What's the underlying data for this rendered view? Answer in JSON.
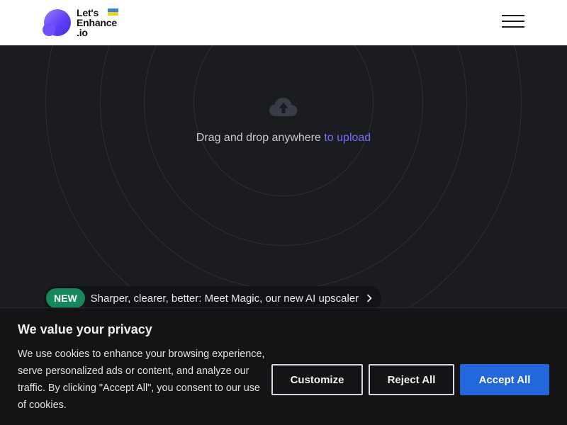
{
  "brand": {
    "logo_text_line1": "Let's",
    "logo_text_line2": "Enhance",
    "logo_text_line3": ".io",
    "flag_colors": [
      "#2f86e0",
      "#f5d21a"
    ],
    "accent": "#6f4ff7"
  },
  "header": {
    "menu_icon": "hamburger-icon"
  },
  "hero": {
    "upload_icon": "cloud-upload-icon",
    "drop_text": "Drag and drop anywhere",
    "drop_link": "to upload",
    "link_color": "#7a6cff"
  },
  "announcement": {
    "badge": "NEW",
    "text": "Sharper, clearer, better: Meet Magic, our new AI upscaler",
    "icon": "chevron-right-icon",
    "badge_color": "#14885a"
  },
  "cookie_banner": {
    "title": "We value your privacy",
    "body": "We use cookies to enhance your browsing experience, serve personalized ads or content, and analyze our traffic. By clicking \"Accept All\", you consent to our use of cookies.",
    "customize_label": "Customize",
    "reject_label": "Reject All",
    "accept_label": "Accept All",
    "accept_color": "#2367dc"
  }
}
